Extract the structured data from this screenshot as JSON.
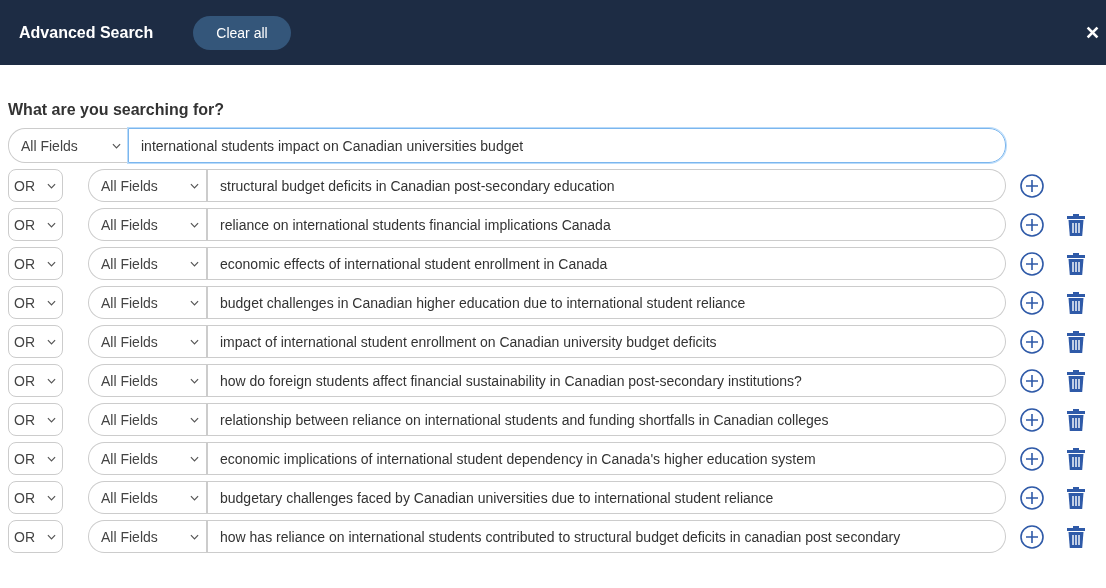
{
  "header": {
    "title": "Advanced Search",
    "clear_button": "Clear all",
    "close": "✕"
  },
  "prompt": "What are you searching for?",
  "rows": [
    {
      "operator": null,
      "field": "All Fields",
      "value": "international students impact on Canadian universities budget",
      "focused": true,
      "addable": false,
      "deletable": false
    },
    {
      "operator": "OR",
      "field": "All Fields",
      "value": "structural budget deficits in Canadian post-secondary education",
      "focused": false,
      "addable": true,
      "deletable": false
    },
    {
      "operator": "OR",
      "field": "All Fields",
      "value": "reliance on international students financial implications Canada",
      "focused": false,
      "addable": true,
      "deletable": true
    },
    {
      "operator": "OR",
      "field": "All Fields",
      "value": "economic effects of international student enrollment in Canada",
      "focused": false,
      "addable": true,
      "deletable": true
    },
    {
      "operator": "OR",
      "field": "All Fields",
      "value": "budget challenges in Canadian higher education due to international student reliance",
      "focused": false,
      "addable": true,
      "deletable": true
    },
    {
      "operator": "OR",
      "field": "All Fields",
      "value": "impact of international student enrollment on Canadian university budget deficits",
      "focused": false,
      "addable": true,
      "deletable": true
    },
    {
      "operator": "OR",
      "field": "All Fields",
      "value": "how do foreign students affect financial sustainability in Canadian post-secondary institutions?",
      "focused": false,
      "addable": true,
      "deletable": true
    },
    {
      "operator": "OR",
      "field": "All Fields",
      "value": "relationship between reliance on international students and funding shortfalls in Canadian colleges",
      "focused": false,
      "addable": true,
      "deletable": true
    },
    {
      "operator": "OR",
      "field": "All Fields",
      "value": "economic implications of international student dependency in Canada's higher education system",
      "focused": false,
      "addable": true,
      "deletable": true
    },
    {
      "operator": "OR",
      "field": "All Fields",
      "value": "budgetary challenges faced by Canadian universities due to international student reliance",
      "focused": false,
      "addable": true,
      "deletable": true
    },
    {
      "operator": "OR",
      "field": "All Fields",
      "value": "how has reliance on international students contributed to structural budget deficits in canadian post secondary",
      "focused": false,
      "addable": true,
      "deletable": true
    }
  ]
}
